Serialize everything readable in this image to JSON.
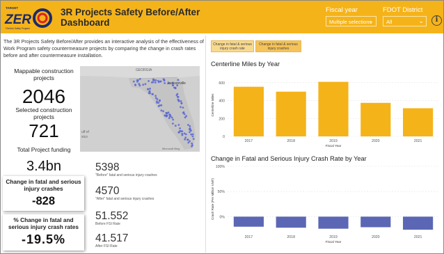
{
  "header": {
    "logo_small": "TARGET",
    "logo_word": "ZER",
    "logo_tag": "Florida's Safety Program",
    "title_line1": "3R Projects Safety Before/After",
    "title_line2": "Dashboard"
  },
  "filters": {
    "fiscal_year": {
      "label": "Fiscal year",
      "value": "Multiple selections"
    },
    "district": {
      "label": "FDOT District",
      "value": "All"
    }
  },
  "description": "The 3R Projects Safety Before/After provides an interactive analysis of the effectiveness of Work Program safety countermeasure projects by comparing the change in crash rates before and after countermeasure installation.",
  "kpis": {
    "mappable_label": "Mappable construction projects",
    "mappable_value": "2046",
    "selected_label": "Selected construction projects",
    "selected_value": "721",
    "funding_label": "Total Project funding",
    "funding_value": "3.4bn",
    "change_label": "Change in fatal and serious injury crashes",
    "change_value": "-828",
    "pct_label": "% Change in fatal and serious injury crash rates",
    "pct_value": "-19.5%"
  },
  "map": {
    "labels": [
      "GEORGIA",
      "Jacksonville",
      "ulf of",
      "xico"
    ],
    "attribution": "Microsoft Bing"
  },
  "stats": [
    {
      "value": "5398",
      "label": "\"Before\" fatal and serious injury crashes"
    },
    {
      "value": "4570",
      "label": "\"After\" fatal and serious injury crashes"
    },
    {
      "value": "51.552",
      "label": "Before FSI Rate"
    },
    {
      "value": "41.517",
      "label": "After FSI Rate"
    }
  ],
  "tabs": [
    {
      "label": "Change in fatal & serious injury crash rate"
    },
    {
      "label": "Change in fatal & serious injury crashes"
    }
  ],
  "charts": {
    "miles_title": "Centerline Miles by Year",
    "rate_title": "Change in Fatal and Serious Injury Crash Rate by Year"
  },
  "colors": {
    "bar_yellow": "#f5b31a",
    "bar_blue": "#5b67b4",
    "header": "#f5b31a"
  },
  "chart_data": [
    {
      "type": "bar",
      "title": "Centerline Miles by Year",
      "categories": [
        "2017",
        "2018",
        "2019",
        "2020",
        "2021"
      ],
      "values": [
        555,
        500,
        610,
        375,
        315
      ],
      "xlabel": "Fiscal Year",
      "ylabel": "Centerline Miles",
      "yticks": [
        "0",
        "200",
        "400",
        "600"
      ],
      "ylim": [
        0,
        700
      ],
      "grid": true
    },
    {
      "type": "bar",
      "title": "Change in Fatal and Serious Injury Crash Rate by Year",
      "categories": [
        "2017",
        "2018",
        "2019",
        "2020",
        "2021"
      ],
      "values": [
        -20,
        -22,
        -24,
        -21,
        -26
      ],
      "xlabel": "Fiscal Year",
      "ylabel": "Crash Rate (Per Million VMT)",
      "yticks": [
        "100%",
        "50%",
        "0%"
      ],
      "ylim": [
        -30,
        100
      ],
      "grid": true
    }
  ]
}
